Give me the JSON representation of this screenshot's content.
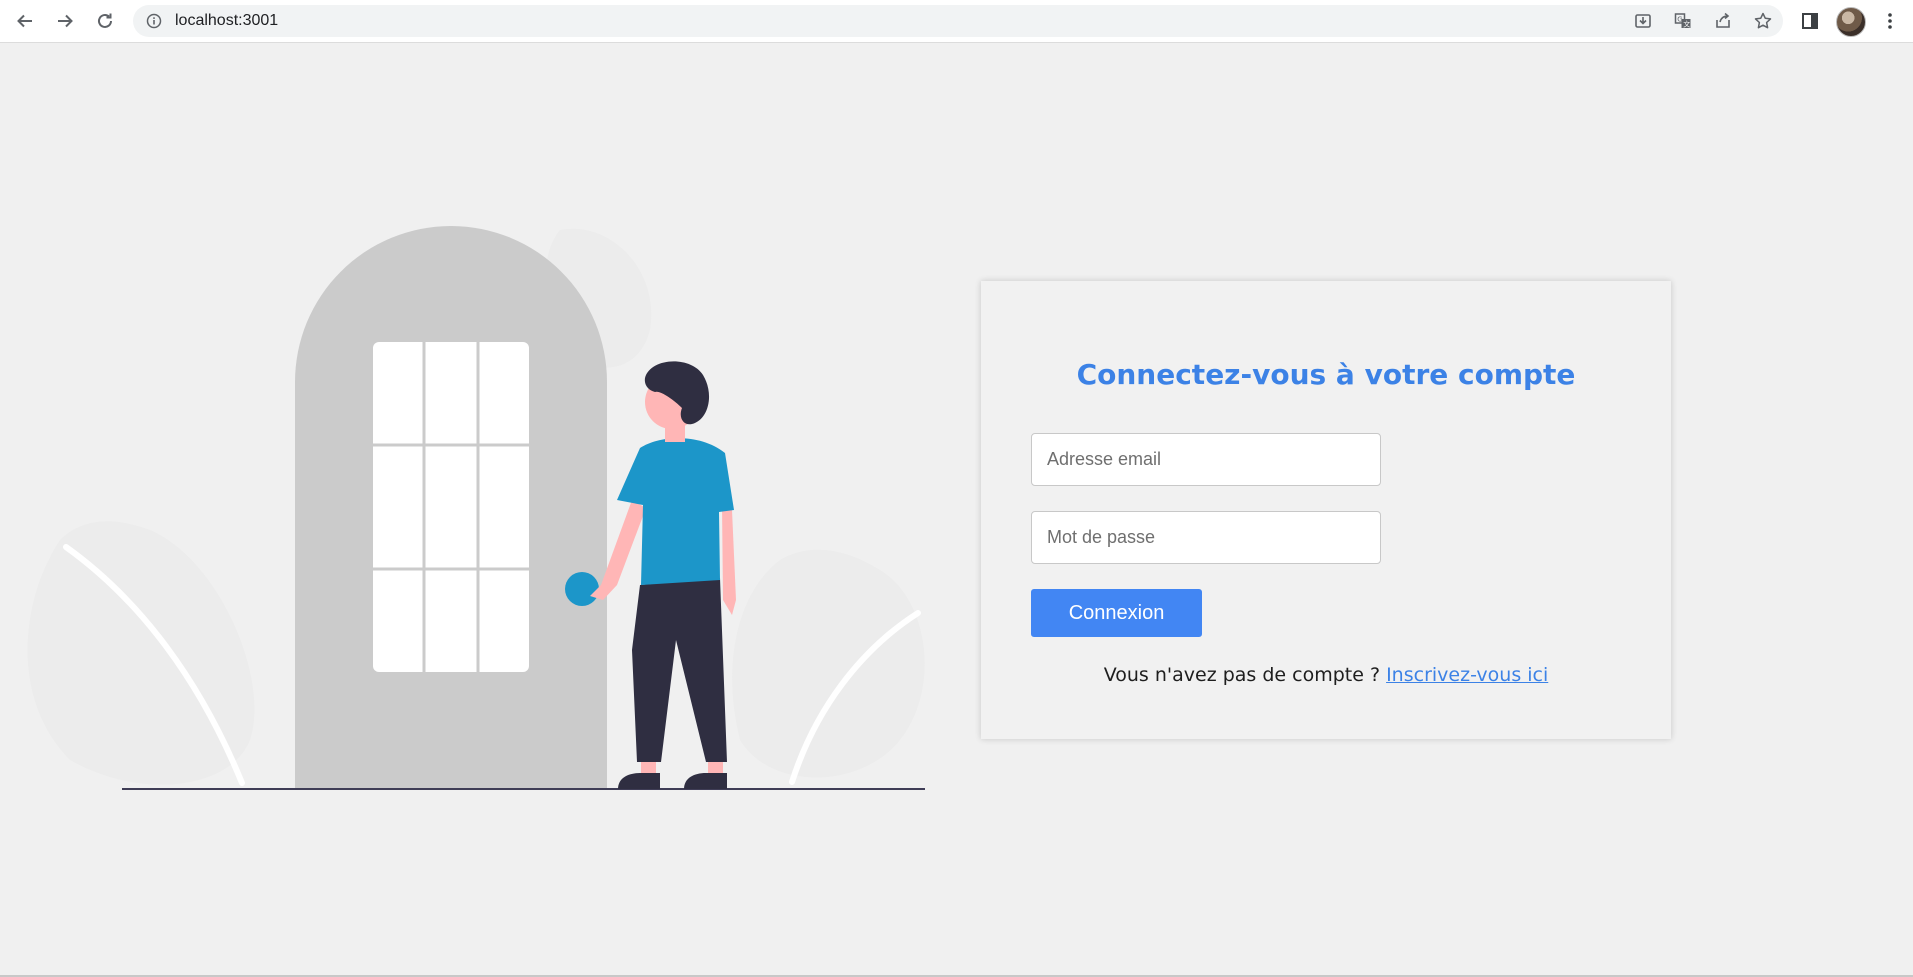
{
  "browser": {
    "url": "localhost:3001",
    "icons": {
      "back": "back-arrow-icon",
      "forward": "forward-arrow-icon",
      "reload": "reload-icon",
      "site_info": "info-icon",
      "install": "install-app-icon",
      "translate": "translate-icon",
      "share": "share-icon",
      "bookmark": "star-icon",
      "side_panel": "side-panel-icon",
      "menu": "kebab-menu-icon"
    }
  },
  "login": {
    "title": "Connectez-vous à votre compte",
    "email_placeholder": "Adresse email",
    "email_value": "",
    "password_placeholder": "Mot de passe",
    "password_value": "",
    "submit_label": "Connexion",
    "signup_prompt": "Vous n'avez pas de compte ? ",
    "signup_link": "Inscrivez-vous ici"
  },
  "colors": {
    "accent": "#4286f3",
    "title": "#3c82e6",
    "page_background": "#f0f0f0",
    "shirt": "#1c96c9",
    "pants": "#2f2e41",
    "skin": "#ffb6b6",
    "door": "#cbcbcb"
  }
}
